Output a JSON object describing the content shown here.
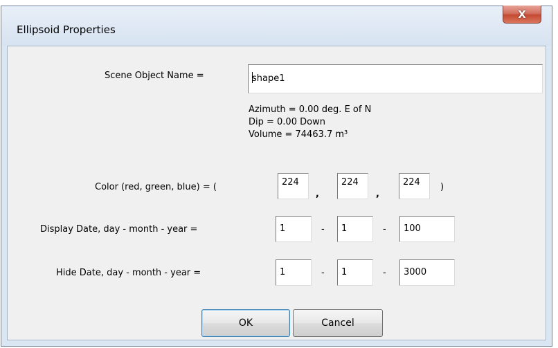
{
  "window": {
    "title": "Ellipsoid Properties",
    "close_glyph": "X"
  },
  "scene_object": {
    "label": "Scene Object Name =",
    "value": "shape1"
  },
  "info": {
    "azimuth": "Azimuth =   0.00 deg. E of N",
    "dip": "Dip =   0.00 Down",
    "volume": "Volume = 74463.7 m³"
  },
  "color": {
    "label": "Color (red, green, blue) = (",
    "red": "224",
    "green": "224",
    "blue": "224",
    "comma": ",",
    "close_paren": ")"
  },
  "display_date": {
    "label": "Display Date, day - month - year =",
    "day": "1",
    "month": "1",
    "year": "100",
    "sep": "-"
  },
  "hide_date": {
    "label": "Hide Date, day - month - year =",
    "day": "1",
    "month": "1",
    "year": "3000",
    "sep": "-"
  },
  "buttons": {
    "ok": "OK",
    "cancel": "Cancel"
  }
}
